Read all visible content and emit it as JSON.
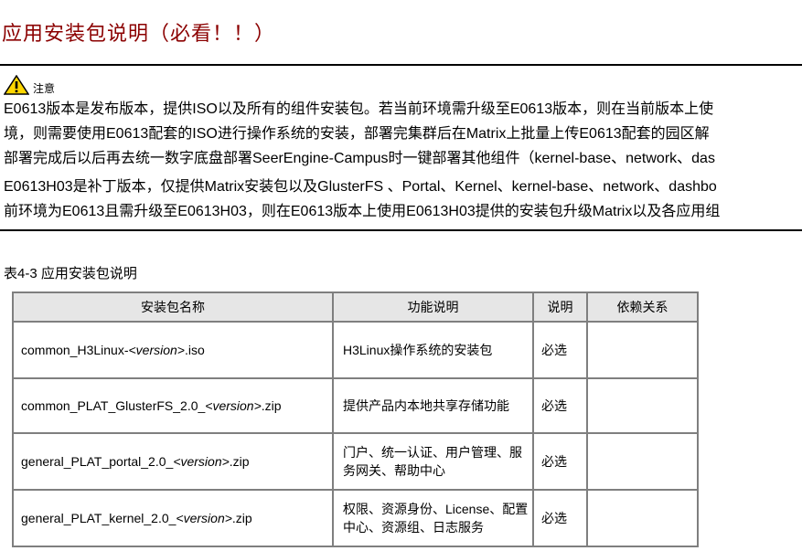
{
  "page": {
    "title": "应用安装包说明（必看！！）"
  },
  "note": {
    "icon": "warning-icon",
    "label": "注意",
    "lines": [
      "E0613版本是发布版本，提供ISO以及所有的组件安装包。若当前环境需升级至E0613版本，则在当前版本上使",
      "境，则需要使用E0613配套的ISO进行操作系统的安装，部署完集群后在Matrix上批量上传E0613配套的园区解",
      "部署完成后以后再去统一数字底盘部署SeerEngine-Campus时一键部署其他组件（kernel-base、network、das",
      "E0613H03是补丁版本，仅提供Matrix安装包以及GlusterFS 、Portal、Kernel、kernel-base、network、dashbo",
      "前环境为E0613且需升级至E0613H03，则在E0613版本上使用E0613H03提供的安装包升级Matrix以及各应用组"
    ]
  },
  "table": {
    "caption": "表4-3 应用安装包说明",
    "headers": [
      "安装包名称",
      "功能说明",
      "说明",
      "依赖关系"
    ],
    "rows": [
      {
        "name_prefix": "common_H3Linux-",
        "version": "<version>",
        "name_suffix": ".iso",
        "func": "H3Linux操作系统的安装包",
        "note": "必选",
        "dep": ""
      },
      {
        "name_prefix": "common_PLAT_GlusterFS_2.0_",
        "version": "<version>",
        "name_suffix": ".zip",
        "func": "提供产品内本地共享存储功能",
        "note": "必选",
        "dep": ""
      },
      {
        "name_prefix": "general_PLAT_portal_2.0_",
        "version": "<version>",
        "name_suffix": ".zip",
        "func": "门户、统一认证、用户管理、服务网关、帮助中心",
        "note": "必选",
        "dep": ""
      },
      {
        "name_prefix": "general_PLAT_kernel_2.0_",
        "version": "<version>",
        "name_suffix": ".zip",
        "func": "权限、资源身份、License、配置中心、资源组、日志服务",
        "note": "必选",
        "dep": ""
      }
    ]
  }
}
